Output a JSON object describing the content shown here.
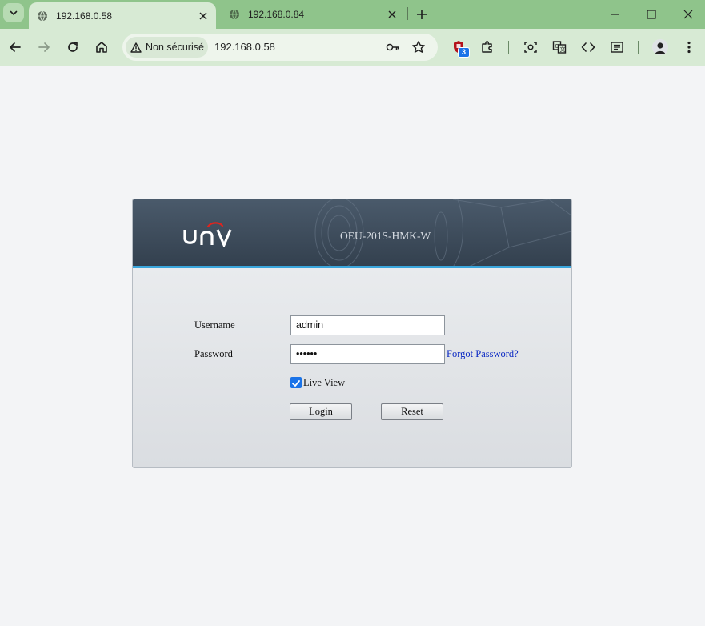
{
  "browser": {
    "tabs": [
      {
        "title": "192.168.0.58",
        "active": true
      },
      {
        "title": "192.168.0.84",
        "active": false
      }
    ],
    "security_label": "Non sécurisé",
    "url": "192.168.0.58",
    "extension_badge": "3"
  },
  "colors": {
    "titlebar": "#8fc48b",
    "toolbar": "#d7ead4",
    "banner_accent": "#3aa6dc",
    "link": "#0d2bc4"
  },
  "login": {
    "logo_text": "UNV",
    "model": "OEU-201S-HMK-W",
    "username_label": "Username",
    "username_value": "admin",
    "password_label": "Password",
    "password_value": "••••••",
    "forgot_password": "Forgot Password?",
    "live_view_label": "Live View",
    "live_view_checked": true,
    "login_button": "Login",
    "reset_button": "Reset"
  }
}
